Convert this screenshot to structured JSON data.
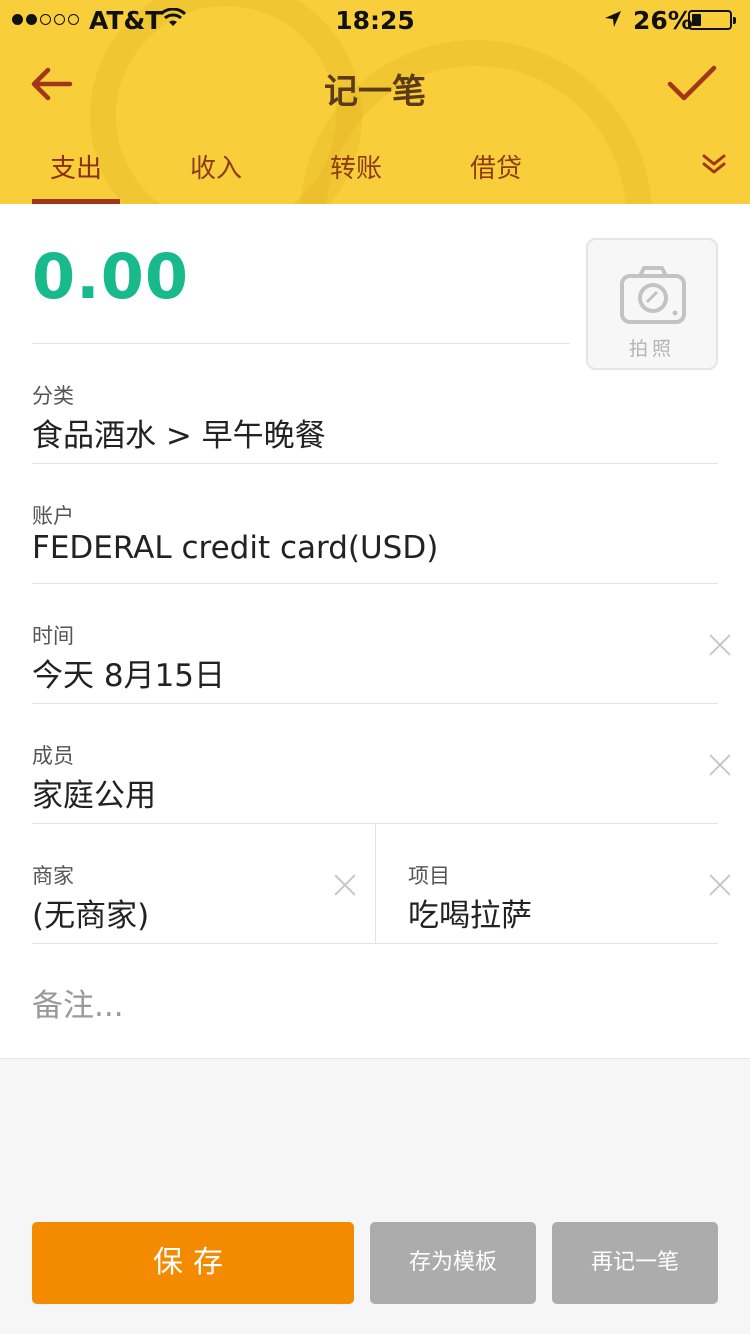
{
  "status_bar": {
    "carrier": "AT&T",
    "time": "18:25",
    "battery": "26%",
    "battery_level": 0.26
  },
  "header": {
    "title": "记一笔",
    "back_icon": "arrow-left-icon",
    "confirm_icon": "checkmark-icon",
    "tabs": [
      {
        "label": "支出",
        "active": true
      },
      {
        "label": "收入",
        "active": false
      },
      {
        "label": "转账",
        "active": false
      },
      {
        "label": "借贷",
        "active": false
      }
    ],
    "more_icon": "double-chevron-down-icon"
  },
  "amount": {
    "value": "0.00",
    "color": "#18b98a"
  },
  "photo": {
    "label": "拍照",
    "icon": "camera-icon"
  },
  "fields": {
    "category": {
      "label": "分类",
      "value": "食品酒水 > 早午晚餐"
    },
    "account": {
      "label": "账户",
      "value": "FEDERAL credit card(USD)"
    },
    "time": {
      "label": "时间",
      "value": "今天 8月15日"
    },
    "member": {
      "label": "成员",
      "value": "家庭公用"
    },
    "merchant": {
      "label": "商家",
      "value": "(无商家)"
    },
    "project": {
      "label": "项目",
      "value": "吃喝拉萨"
    }
  },
  "note": {
    "placeholder": "备注..."
  },
  "buttons": {
    "save": "保存",
    "save_as_template": "存为模板",
    "record_again": "再记一笔"
  },
  "colors": {
    "header_bg": "#f8cf3a",
    "accent_text": "#8e3b16",
    "save_button": "#f48a00",
    "secondary_button": "#acacac"
  }
}
